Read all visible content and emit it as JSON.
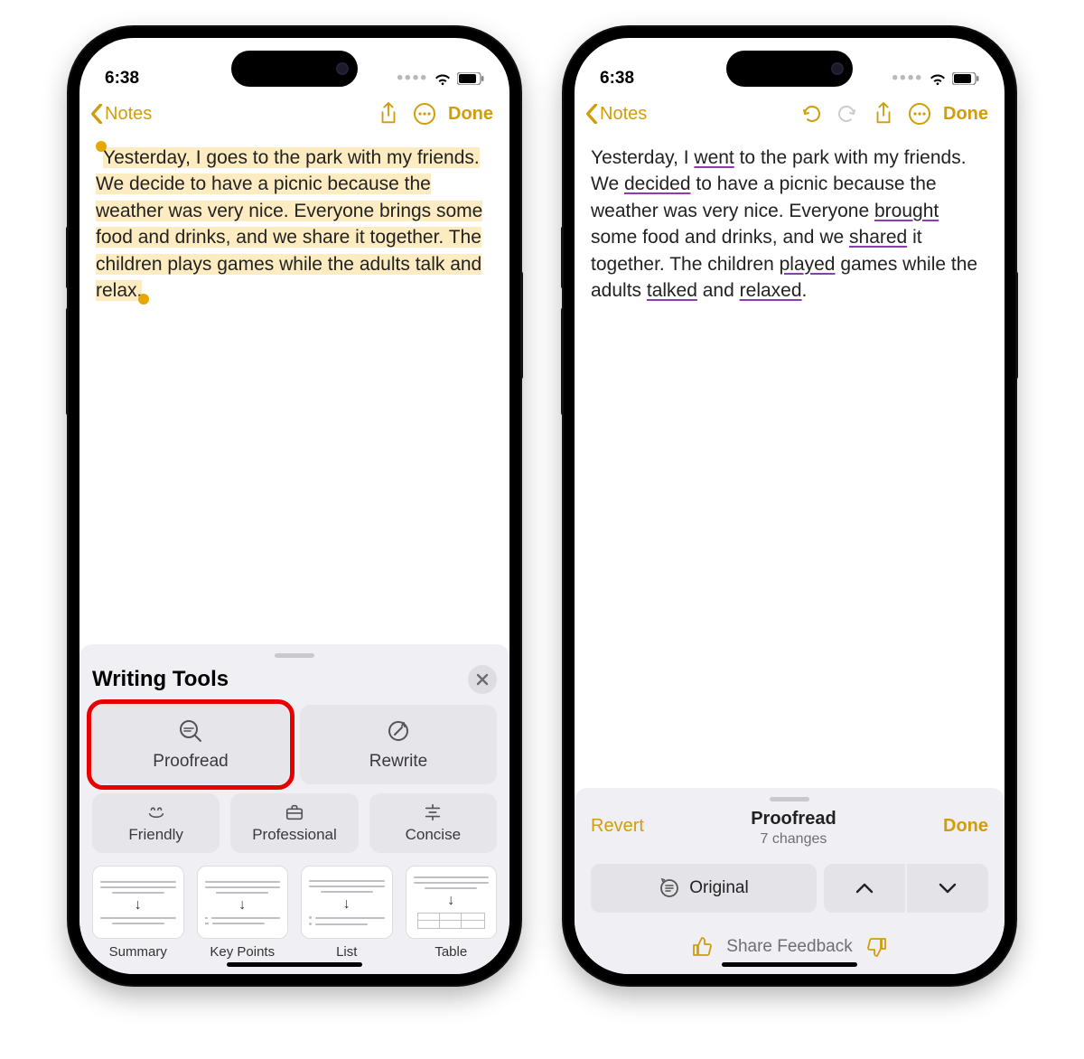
{
  "status": {
    "time": "6:38"
  },
  "nav": {
    "back": "Notes",
    "done": "Done"
  },
  "left": {
    "noteText": "Yesterday, I goes to the park with my friends. We decide to have a picnic because the weather was very nice. Everyone brings some food and drinks, and we share it together. The children plays games while the adults talk and relax.",
    "sheetTitle": "Writing Tools",
    "proofread": "Proofread",
    "rewrite": "Rewrite",
    "friendly": "Friendly",
    "professional": "Professional",
    "concise": "Concise",
    "cards": {
      "summary": "Summary",
      "keypoints": "Key Points",
      "list": "List",
      "table": "Table"
    }
  },
  "right": {
    "para": {
      "t1": "Yesterday, I ",
      "w1": "went",
      "t2": " to the park with my friends. We ",
      "w2": "decided",
      "t3": " to have a picnic because the weather was very nice. Everyone ",
      "w3": "brought",
      "t4": " some food and drinks, and we ",
      "w4": "shared",
      "t5": " it together. The children ",
      "w5": "played",
      "t6": " games while the adults ",
      "w6": "talked",
      "t7": " and ",
      "w7": "relaxed",
      "t8": "."
    },
    "sheet": {
      "revert": "Revert",
      "title": "Proofread",
      "changes": "7 changes",
      "done": "Done",
      "original": "Original",
      "feedback": "Share Feedback"
    }
  }
}
